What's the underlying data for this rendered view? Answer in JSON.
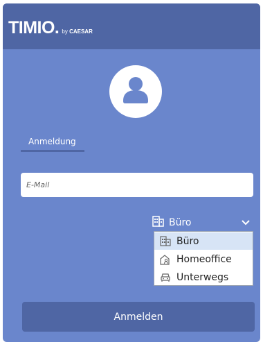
{
  "brand": {
    "name": "TIMIO.",
    "by": "by",
    "company": "CAESAR"
  },
  "login_tab": "Anmeldung",
  "email": {
    "placeholder": "E-Mail",
    "value": ""
  },
  "location": {
    "selected": "Büro",
    "options": [
      {
        "label": "Büro",
        "icon": "building-icon"
      },
      {
        "label": "Homeoffice",
        "icon": "home-office-icon"
      },
      {
        "label": "Unterwegs",
        "icon": "car-icon"
      }
    ]
  },
  "submit_label": "Anmelden",
  "colors": {
    "header": "#4f66a4",
    "background": "#6a86cc",
    "selected_option": "#d7e4f6"
  }
}
